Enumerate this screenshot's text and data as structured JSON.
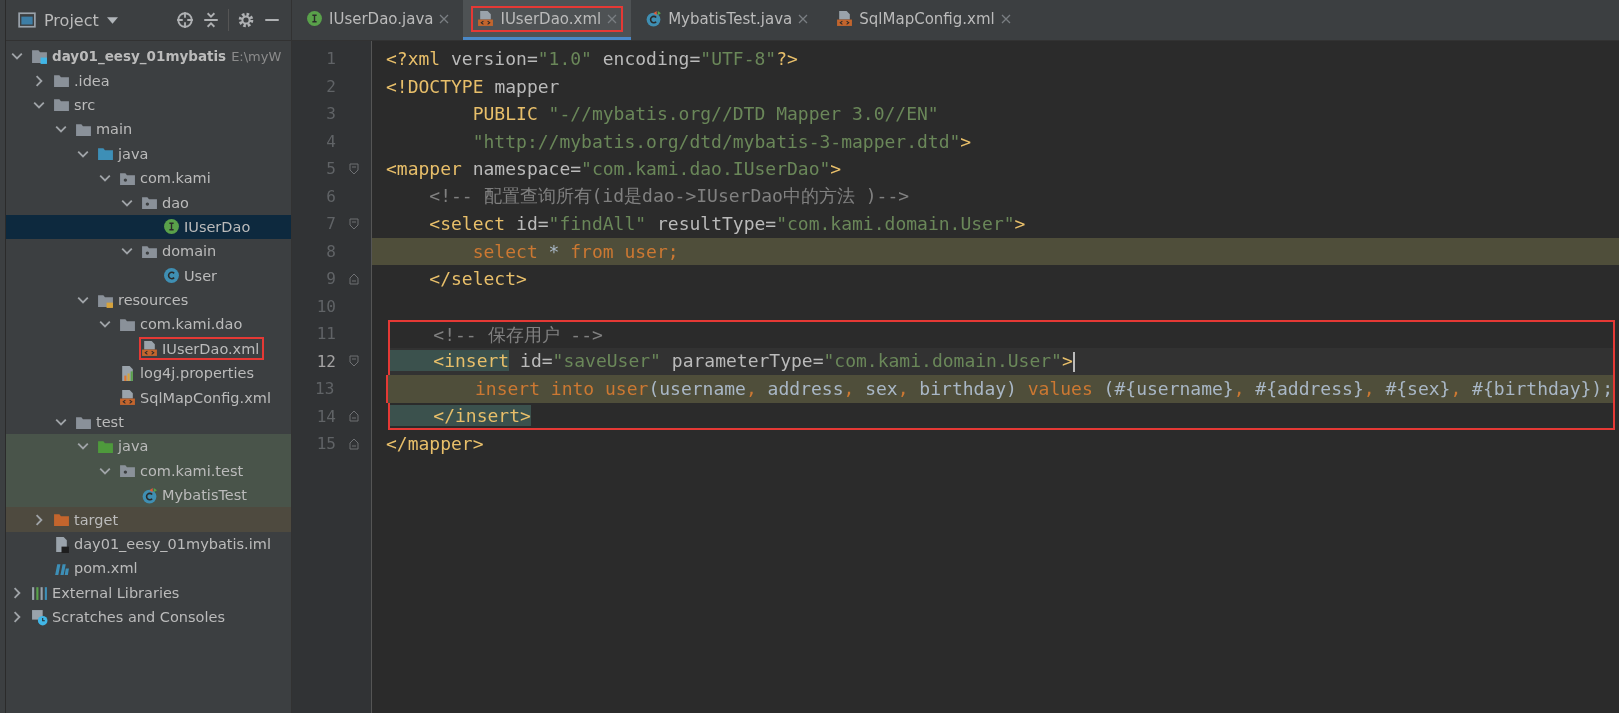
{
  "sidebar": {
    "title": "Project",
    "tree": [
      {
        "label": "day01_eesy_01mybatis",
        "kind": "project",
        "path": "E:\\myW",
        "expanded": true,
        "selected": false,
        "boxed": false,
        "children": [
          {
            "label": ".idea",
            "kind": "folder",
            "expanded": false,
            "selected": false,
            "boxed": false
          },
          {
            "label": "src",
            "kind": "folder",
            "expanded": true,
            "selected": false,
            "boxed": false,
            "children": [
              {
                "label": "main",
                "kind": "folder",
                "expanded": true,
                "selected": false,
                "boxed": false,
                "children": [
                  {
                    "label": "java",
                    "kind": "source-folder",
                    "expanded": true,
                    "selected": false,
                    "boxed": false,
                    "children": [
                      {
                        "label": "com.kami",
                        "kind": "package",
                        "expanded": true,
                        "selected": false,
                        "boxed": false,
                        "children": [
                          {
                            "label": "dao",
                            "kind": "package",
                            "expanded": true,
                            "selected": false,
                            "boxed": false,
                            "children": [
                              {
                                "label": "IUserDao",
                                "kind": "interface",
                                "selected": true,
                                "boxed": false
                              }
                            ]
                          },
                          {
                            "label": "domain",
                            "kind": "package",
                            "expanded": true,
                            "selected": false,
                            "boxed": false,
                            "children": [
                              {
                                "label": "User",
                                "kind": "class",
                                "selected": false,
                                "boxed": false
                              }
                            ]
                          }
                        ]
                      }
                    ]
                  },
                  {
                    "label": "resources",
                    "kind": "resources-folder",
                    "expanded": true,
                    "selected": false,
                    "boxed": false,
                    "children": [
                      {
                        "label": "com.kami.dao",
                        "kind": "folder",
                        "expanded": true,
                        "selected": false,
                        "boxed": false,
                        "children": [
                          {
                            "label": "IUserDao.xml",
                            "kind": "xml",
                            "selected": false,
                            "boxed": true
                          }
                        ]
                      },
                      {
                        "label": "log4j.properties",
                        "kind": "properties",
                        "selected": false,
                        "boxed": false
                      },
                      {
                        "label": "SqlMapConfig.xml",
                        "kind": "xml",
                        "selected": false,
                        "boxed": false
                      }
                    ]
                  }
                ]
              },
              {
                "label": "test",
                "kind": "folder",
                "expanded": true,
                "selected": false,
                "boxed": false,
                "children": [
                  {
                    "label": "java",
                    "kind": "test-folder",
                    "test_source": true,
                    "expanded": true,
                    "selected": false,
                    "boxed": false,
                    "children": [
                      {
                        "label": "com.kami.test",
                        "kind": "package",
                        "test_source": true,
                        "expanded": true,
                        "selected": false,
                        "boxed": false,
                        "children": [
                          {
                            "label": "MybatisTest",
                            "kind": "test-class",
                            "test_source": true,
                            "selected": false,
                            "boxed": false
                          }
                        ]
                      }
                    ]
                  }
                ]
              }
            ]
          },
          {
            "label": "target",
            "kind": "excluded-folder",
            "excluded": true,
            "expanded": false,
            "selected": false,
            "boxed": false
          },
          {
            "label": "day01_eesy_01mybatis.iml",
            "kind": "iml",
            "selected": false,
            "boxed": false
          },
          {
            "label": "pom.xml",
            "kind": "maven",
            "selected": false,
            "boxed": false
          }
        ]
      },
      {
        "label": "External Libraries",
        "kind": "libraries",
        "expanded": false,
        "selected": false,
        "boxed": false
      },
      {
        "label": "Scratches and Consoles",
        "kind": "scratches",
        "expanded": false,
        "selected": false,
        "boxed": false
      }
    ]
  },
  "tabs": [
    {
      "label": "IUserDao.java",
      "kind": "interface",
      "selected": false,
      "boxed": false
    },
    {
      "label": "IUserDao.xml",
      "kind": "xml",
      "selected": true,
      "boxed": true
    },
    {
      "label": "MybatisTest.java",
      "kind": "test-class",
      "selected": false,
      "boxed": false
    },
    {
      "label": "SqlMapConfig.xml",
      "kind": "xml",
      "selected": false,
      "boxed": false
    }
  ],
  "editor": {
    "lines": [
      {
        "number": "1",
        "tokens": [
          {
            "text": "<?xml",
            "kind": "tag"
          },
          {
            "text": " version=",
            "kind": "attr"
          },
          {
            "text": "\"1.0\"",
            "kind": "string"
          },
          {
            "text": " encoding=",
            "kind": "attr"
          },
          {
            "text": "\"UTF-8\"",
            "kind": "string"
          },
          {
            "text": "?>",
            "kind": "tag"
          }
        ]
      },
      {
        "number": "2",
        "tokens": [
          {
            "text": "<!DOCTYPE",
            "kind": "tag"
          },
          {
            "text": " mapper",
            "kind": "attr"
          }
        ]
      },
      {
        "number": "3",
        "tokens": [
          {
            "text": "        PUBLIC",
            "kind": "tag"
          },
          {
            "text": " \"-//mybatis.org//DTD Mapper 3.0//EN\"",
            "kind": "string"
          }
        ]
      },
      {
        "number": "4",
        "tokens": [
          {
            "text": "        \"http://mybatis.org/dtd/mybatis-3-mapper.dtd\"",
            "kind": "string"
          },
          {
            "text": ">",
            "kind": "tag"
          }
        ]
      },
      {
        "number": "5",
        "fold_start": true,
        "tokens": [
          {
            "text": "<mapper",
            "kind": "tag"
          },
          {
            "text": " namespace=",
            "kind": "attr"
          },
          {
            "text": "\"com.kami.dao.IUserDao\"",
            "kind": "string"
          },
          {
            "text": ">",
            "kind": "tag"
          }
        ]
      },
      {
        "number": "6",
        "tokens": [
          {
            "text": "    <!-- 配置查询所有(id是dao->IUserDao中的方法 )-->",
            "kind": "comment"
          }
        ]
      },
      {
        "number": "7",
        "fold_start": true,
        "tokens": [
          {
            "text": "    <select",
            "kind": "tag"
          },
          {
            "text": " id=",
            "kind": "attr"
          },
          {
            "text": "\"findAll\"",
            "kind": "string"
          },
          {
            "text": " resultType=",
            "kind": "attr"
          },
          {
            "text": "\"com.kami.domain.User\"",
            "kind": "string"
          },
          {
            "text": ">",
            "kind": "tag"
          }
        ]
      },
      {
        "number": "8",
        "injected": true,
        "tokens": [
          {
            "text": "        select",
            "kind": "keyword"
          },
          {
            "text": " * ",
            "kind": "plain"
          },
          {
            "text": "from user;",
            "kind": "keyword"
          }
        ]
      },
      {
        "number": "9",
        "fold_end": true,
        "tokens": [
          {
            "text": "    </select>",
            "kind": "tag"
          }
        ]
      },
      {
        "number": "10"
      },
      {
        "number": "11",
        "boxed": true,
        "tokens": [
          {
            "text": "    <!-- 保存用户 -->",
            "kind": "comment"
          }
        ]
      },
      {
        "number": "12",
        "boxed": true,
        "current": true,
        "fold_start": true,
        "tokens": [
          {
            "text": "    <insert",
            "kind": "tag",
            "matched": true
          },
          {
            "text": " id=",
            "kind": "attr"
          },
          {
            "text": "\"saveUser\"",
            "kind": "string"
          },
          {
            "text": " parameterType=",
            "kind": "attr"
          },
          {
            "text": "\"com.kami.domain.User\"",
            "kind": "string"
          },
          {
            "text": ">",
            "kind": "tag"
          }
        ]
      },
      {
        "number": "13",
        "boxed": true,
        "injected": true,
        "tokens": [
          {
            "text": "        insert into user",
            "kind": "keyword"
          },
          {
            "text": "(username",
            "kind": "plain"
          },
          {
            "text": ",",
            "kind": "keyword"
          },
          {
            "text": " address",
            "kind": "plain"
          },
          {
            "text": ",",
            "kind": "keyword"
          },
          {
            "text": " sex",
            "kind": "plain"
          },
          {
            "text": ",",
            "kind": "keyword"
          },
          {
            "text": " birthday) ",
            "kind": "plain"
          },
          {
            "text": "values",
            "kind": "keyword"
          },
          {
            "text": " (#{username}",
            "kind": "plain"
          },
          {
            "text": ",",
            "kind": "keyword"
          },
          {
            "text": " #{address}",
            "kind": "plain"
          },
          {
            "text": ",",
            "kind": "keyword"
          },
          {
            "text": " #{sex}",
            "kind": "plain"
          },
          {
            "text": ",",
            "kind": "keyword"
          },
          {
            "text": " #{birthday});",
            "kind": "plain"
          }
        ]
      },
      {
        "number": "14",
        "boxed": true,
        "fold_end": true,
        "tokens": [
          {
            "text": "    </insert>",
            "kind": "tag",
            "matched": true
          }
        ]
      },
      {
        "number": "15",
        "fold_end": true,
        "tokens": [
          {
            "text": "</mapper>",
            "kind": "tag"
          }
        ]
      }
    ]
  }
}
